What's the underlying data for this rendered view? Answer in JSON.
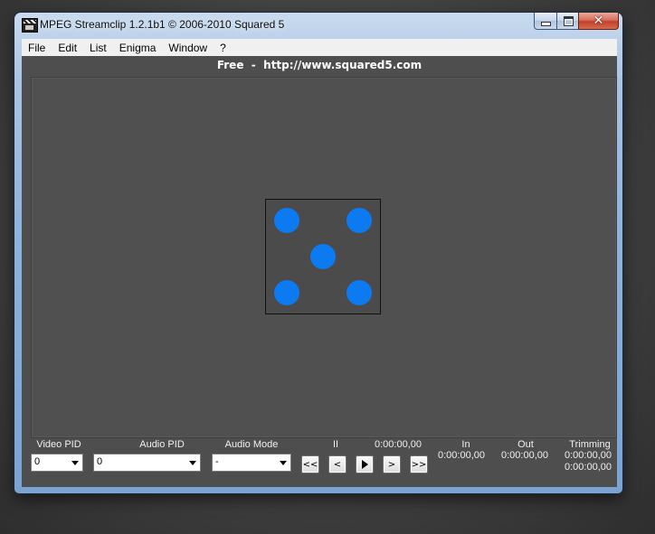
{
  "window": {
    "title": "MPEG Streamclip 1.2.1b1  ©  2006-2010 Squared 5"
  },
  "menu": {
    "items": [
      "File",
      "Edit",
      "List",
      "Enigma",
      "Window",
      "?"
    ]
  },
  "banner": {
    "text": "Free  -  http://www.squared5.com"
  },
  "placeholder": {
    "icon": "dice-five-icon",
    "dot_color": "#0c7af1"
  },
  "controls": {
    "video_pid": {
      "label": "Video PID",
      "value": "0"
    },
    "audio_pid": {
      "label": "Audio PID",
      "value": "0"
    },
    "audio_mode": {
      "label": "Audio Mode",
      "value": "-"
    },
    "pause_indicator": "II",
    "current_time": "0:00:00,00",
    "nav_buttons": [
      "<<",
      "<",
      ">",
      ">",
      ">>"
    ],
    "in": {
      "label": "In",
      "value": "0:00:00,00"
    },
    "out": {
      "label": "Out",
      "value": "0:00:00,00"
    },
    "trimming": {
      "label": "Trimming",
      "value1": "0:00:00,00",
      "value2": "0:00:00,00"
    }
  }
}
